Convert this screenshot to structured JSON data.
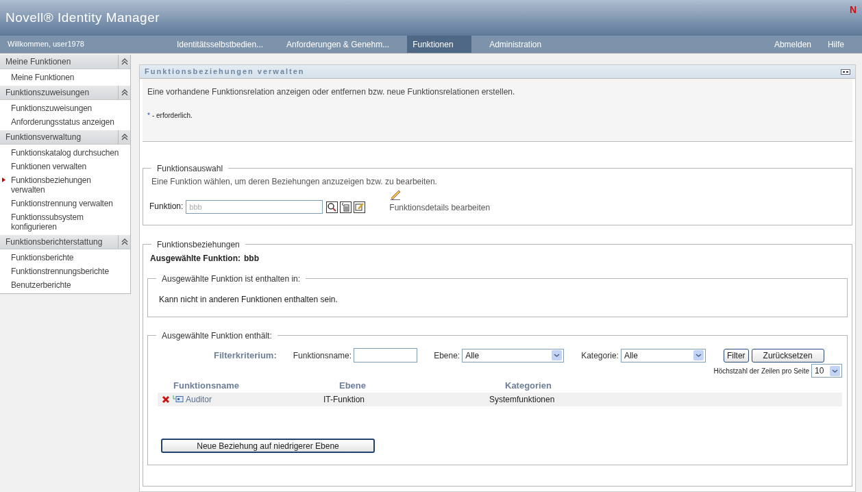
{
  "header": {
    "title": "Novell® Identity Manager",
    "logo_letter": "N"
  },
  "nav": {
    "welcome": "Willkommen, user1978",
    "tabs": [
      {
        "label": "Identitätsselbstbedien...",
        "selected": false
      },
      {
        "label": "Anforderungen & Genehm...",
        "selected": false
      },
      {
        "label": "Funktionen",
        "selected": true
      },
      {
        "label": "Administration",
        "selected": false
      }
    ],
    "links": [
      "Abmelden",
      "Hilfe"
    ]
  },
  "sidebar": {
    "sections": [
      {
        "title": "Meine Funktionen",
        "expanded": true,
        "items": [
          {
            "label": "Meine Funktionen",
            "selected": false
          }
        ]
      },
      {
        "title": "Funktionszuweisungen",
        "expanded": true,
        "items": [
          {
            "label": "Funktionszuweisungen",
            "selected": false
          },
          {
            "label": "Anforderungsstatus anzeigen",
            "selected": false
          }
        ]
      },
      {
        "title": "Funktionsverwaltung",
        "expanded": true,
        "items": [
          {
            "label": "Funktionskatalog durchsuchen",
            "selected": false
          },
          {
            "label": "Funktionen verwalten",
            "selected": false
          },
          {
            "label": "Funktionsbeziehungen verwalten",
            "selected": true
          },
          {
            "label": "Funktionstrennung verwalten",
            "selected": false
          },
          {
            "label": "Funktionssubsystem konfigurieren",
            "selected": false
          }
        ]
      },
      {
        "title": "Funktionsberichterstattung",
        "expanded": true,
        "items": [
          {
            "label": "Funktionsberichte",
            "selected": false
          },
          {
            "label": "Funktionstrennungsberichte",
            "selected": false
          },
          {
            "label": "Benutzerberichte",
            "selected": false
          }
        ]
      }
    ]
  },
  "panel": {
    "title": "Funktionsbeziehungen verwalten",
    "description": "Eine vorhandene Funktionsrelation anzeigen oder entfernen bzw. neue Funktionsrelationen erstellen.",
    "required_mark": "*",
    "required_text": "- erforderlich.",
    "selection": {
      "legend": "Funktionsauswahl",
      "hint": "Eine Funktion wählen, um deren Beziehungen anzuzeigen bzw. zu bearbeiten.",
      "field_label": "Funktion:",
      "field_value": "bbb",
      "edit_link": "Funktionsdetails bearbeiten"
    },
    "relations": {
      "legend": "Funktionsbeziehungen",
      "selected_label": "Ausgewählte Funktion:",
      "selected_value": "bbb",
      "contained_in": {
        "legend": "Ausgewählte Funktion ist enthalten in:",
        "message": "Kann nicht in anderen Funktionen enthalten sein."
      },
      "contains": {
        "legend": "Ausgewählte Funktion enthält:",
        "filter_label": "Filterkriterium:",
        "name_label": "Funktionsname:",
        "level_label": "Ebene:",
        "level_value": "Alle",
        "category_label": "Kategorie:",
        "category_value": "Alle",
        "filter_button": "Filter",
        "reset_button": "Zurücksetzen",
        "rows_label": "Höchstzahl der Zeilen pro Seite",
        "rows_value": "10",
        "columns": [
          "Funktionsname",
          "Ebene",
          "Kategorien"
        ],
        "rows": [
          {
            "name": "Auditor",
            "level": "IT-Funktion",
            "category": "Systemfunktionen"
          }
        ],
        "new_button": "Neue Beziehung auf niedrigerer Ebene"
      }
    }
  }
}
